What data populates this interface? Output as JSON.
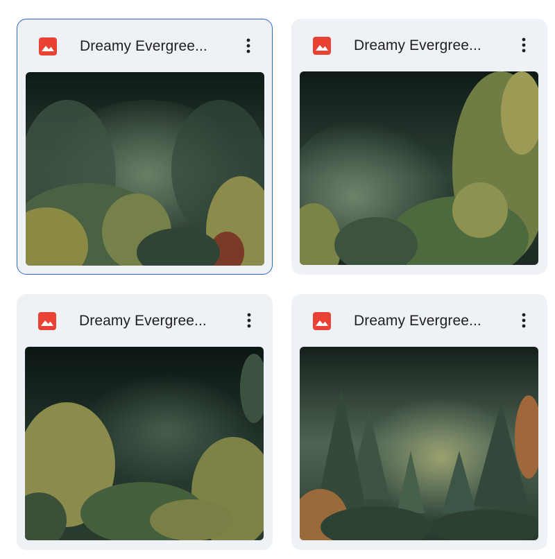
{
  "files": [
    {
      "title": "Dreamy Evergree...",
      "type_icon": "image-file-icon",
      "menu_icon": "more-vert-icon",
      "selected": true,
      "thumbnail_alt": "Misty painted forest with leafy evergreen foliage"
    },
    {
      "title": "Dreamy Evergree...",
      "type_icon": "image-file-icon",
      "menu_icon": "more-vert-icon",
      "selected": false,
      "thumbnail_alt": "Misty painted forest with leafy evergreen foliage"
    },
    {
      "title": "Dreamy Evergree...",
      "type_icon": "image-file-icon",
      "menu_icon": "more-vert-icon",
      "selected": false,
      "thumbnail_alt": "Misty painted forest with leafy evergreen foliage"
    },
    {
      "title": "Dreamy Evergree...",
      "type_icon": "image-file-icon",
      "menu_icon": "more-vert-icon",
      "selected": false,
      "thumbnail_alt": "Misty painted forest with pine trees"
    }
  ],
  "colors": {
    "card_background": "#eef1f6",
    "selected_border": "#2f66c9",
    "image_icon_red": "#e94235",
    "title_text": "#1f1f1f"
  }
}
